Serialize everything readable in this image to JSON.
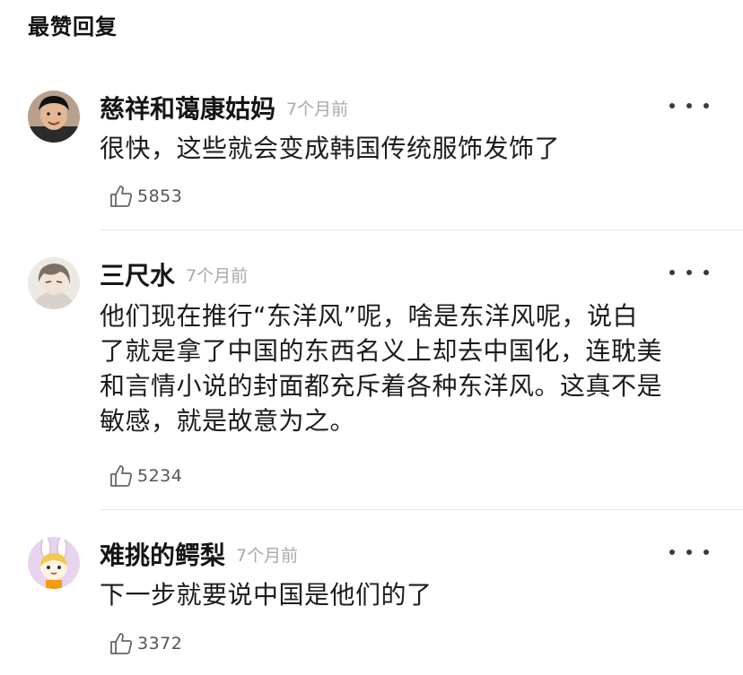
{
  "section_title": "最赞回复",
  "comments": [
    {
      "username": "慈祥和蔼康姑妈",
      "time": "7个月前",
      "lines": [
        "很快，这些就会变成韩国传统服饰发饰了"
      ],
      "likes": "5853",
      "avatar": "photo-woman-avatar"
    },
    {
      "username": "三尺水",
      "time": "7个月前",
      "lines": [
        "他们现在推行“东洋风”呢，啥是东洋风呢，说白",
        "了就是拿了中国的东西名义上却去中国化，连耽美",
        "和言情小说的封面都充斥着各种东洋风。这真不是",
        "敏感，就是故意为之。"
      ],
      "likes": "5234",
      "avatar": "anime-boy-avatar"
    },
    {
      "username": "难挑的鳄梨",
      "time": "7个月前",
      "lines": [
        "下一步就要说中国是他们的了"
      ],
      "likes": "3372",
      "avatar": "bunny-girl-avatar"
    }
  ],
  "icons": {
    "more": "more-dots-icon",
    "like": "thumbs-up-icon"
  }
}
